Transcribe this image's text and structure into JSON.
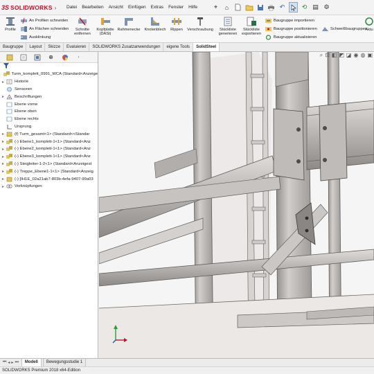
{
  "app": {
    "logo_ds": "3S",
    "logo_text": "SOLIDWORKS",
    "status": "SOLIDWORKS Premium 2018 x64-Edition"
  },
  "menu": [
    "Datei",
    "Bearbeiten",
    "Ansicht",
    "Einfügen",
    "Extras",
    "Fenster",
    "Hilfe"
  ],
  "commands": {
    "profile": "Profile",
    "cut_on_profile": "An Profilen schneiden",
    "cut_on_faces": "An Flächen schneiden",
    "notch": "Ausklinkung",
    "cut_removal": [
      "Schnitte",
      "entfernen"
    ],
    "head_plate": [
      "Kopfplatte",
      "(DASt)"
    ],
    "frame_corner": "Rahmenecke",
    "gusset": "Knotenblech",
    "ribs": "Rippen",
    "bolting": "Verschraubung",
    "bom_generate": [
      "Stückliste",
      "generieren"
    ],
    "bom_export": [
      "Stückliste",
      "exportieren"
    ],
    "asm_import": "Baugruppe importieren",
    "asm_position": "Baugruppe positionieren",
    "asm_update": "Baugruppe aktualisieren",
    "weld_assemblies": "Schweißbaugruppen",
    "update_partial": "Aktu"
  },
  "tabs": [
    "Baugruppe",
    "Layout",
    "Skizze",
    "Evaluieren",
    "SOLIDWORKS Zusatzanwendungen",
    "eigene Tools",
    "SolidSteel"
  ],
  "active_tab": "SolidSteel",
  "tree": {
    "root": "Turm_komplett_0991_WCA  (Standard<Anzeige",
    "items": [
      {
        "exp": "▸",
        "icon": "history-icon",
        "label": "Historie"
      },
      {
        "exp": "",
        "icon": "sensor-icon",
        "label": "Sensoren"
      },
      {
        "exp": "▸",
        "icon": "annotation-icon",
        "label": "Beschriftungen"
      },
      {
        "exp": "",
        "icon": "plane-icon",
        "label": "Ebene vorne"
      },
      {
        "exp": "",
        "icon": "plane-icon",
        "label": "Ebene oben"
      },
      {
        "exp": "",
        "icon": "plane-icon",
        "label": "Ebene rechts"
      },
      {
        "exp": "",
        "icon": "origin-icon",
        "label": "Ursprung"
      },
      {
        "exp": "▸",
        "icon": "part-icon",
        "label": "(f) Turm_gesamt<1> (Standard<<Standar"
      },
      {
        "exp": "▸",
        "icon": "assembly-icon",
        "label": "(-) Ebene1_komplett-1<1> (Standard<Anz"
      },
      {
        "exp": "▸",
        "icon": "assembly-icon",
        "label": "(-) Ebene2_komplett-1<1> (Standard<Anz"
      },
      {
        "exp": "▸",
        "icon": "assembly-icon",
        "label": "(-) Ebene3_komplett-1<1> (Standard<Anz"
      },
      {
        "exp": "▸",
        "icon": "assembly-icon",
        "label": "(-) Steigleiter-1-2<1> (Standard<Anzeigest"
      },
      {
        "exp": "▸",
        "icon": "assembly-icon",
        "label": "(-) Treppe_Ebene1-1<1> (Standard<Anzeig"
      },
      {
        "exp": "▸",
        "icon": "part-icon",
        "label": "(-) [IH1E_02a21ab7-803b-4efa-9407-99a03"
      },
      {
        "exp": "▸",
        "icon": "mates-icon",
        "label": "Verknüpfungen"
      }
    ]
  },
  "bottom_tabs": [
    "Modell",
    "Bewegungsstudie 1"
  ],
  "colors": {
    "accent": "#c8102e",
    "steel_light": "#c9c5c3",
    "steel_mid": "#a9a5a3",
    "steel_dark": "#6e6a68",
    "viewport_bg": "#f4f4f4"
  }
}
